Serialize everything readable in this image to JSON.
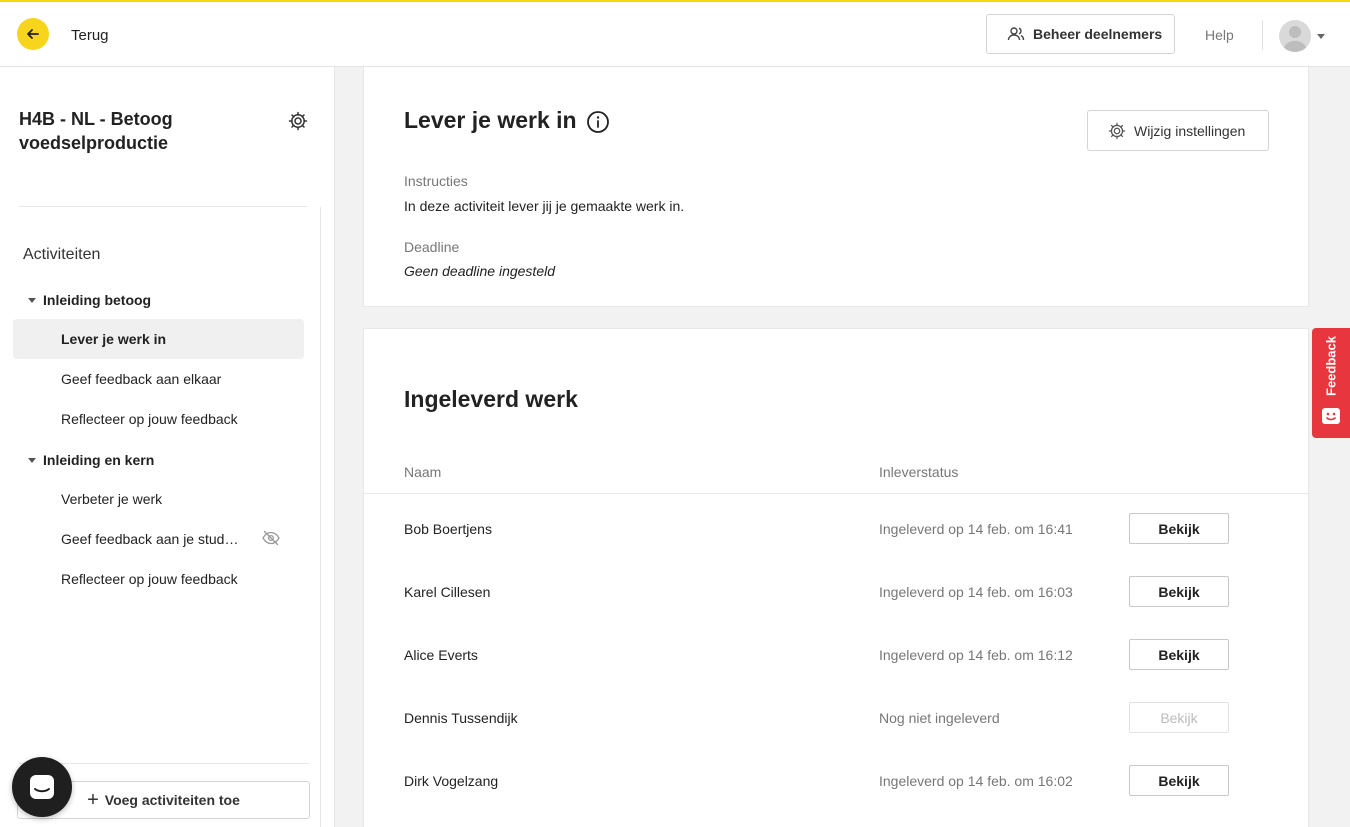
{
  "topbar": {
    "back_label": "Terug",
    "manage_label": "Beheer deelnemers",
    "help_label": "Help"
  },
  "sidebar": {
    "course_title": "H4B - NL - Betoog voedselproductie",
    "activities_heading": "Activiteiten",
    "groups": [
      {
        "label": "Inleiding betoog",
        "items": [
          "Lever je werk in",
          "Geef feedback aan elkaar",
          "Reflecteer op jouw feedback"
        ]
      },
      {
        "label": "Inleiding en kern",
        "items": [
          "Verbeter je werk",
          "Geef feedback aan je stud…",
          "Reflecteer op jouw feedback"
        ]
      }
    ],
    "add_label": "Voeg activiteiten toe"
  },
  "activity": {
    "title": "Lever je werk in",
    "settings_label": "Wijzig instellingen",
    "instructions_label": "Instructies",
    "instructions_text": "In deze activiteit lever jij je gemaakte werk in.",
    "deadline_label": "Deadline",
    "deadline_text": "Geen deadline ingesteld"
  },
  "submitted": {
    "title": "Ingeleverd werk",
    "col_name": "Naam",
    "col_status": "Inleverstatus",
    "rows": [
      {
        "name": "Bob Boertjens",
        "status": "Ingeleverd op 14 feb. om 16:41",
        "action": "Bekijk",
        "enabled": true
      },
      {
        "name": "Karel Cillesen",
        "status": "Ingeleverd op 14 feb. om 16:03",
        "action": "Bekijk",
        "enabled": true
      },
      {
        "name": "Alice Everts",
        "status": "Ingeleverd op 14 feb. om 16:12",
        "action": "Bekijk",
        "enabled": true
      },
      {
        "name": "Dennis Tussendijk",
        "status": "Nog niet ingeleverd",
        "action": "Bekijk",
        "enabled": false
      },
      {
        "name": "Dirk Vogelzang",
        "status": "Ingeleverd op 14 feb. om 16:02",
        "action": "Bekijk",
        "enabled": true
      }
    ]
  },
  "feedback_tab": {
    "label": "Feedback"
  },
  "colors": {
    "accent": "#f7d51d",
    "feedback": "#e8363f"
  }
}
